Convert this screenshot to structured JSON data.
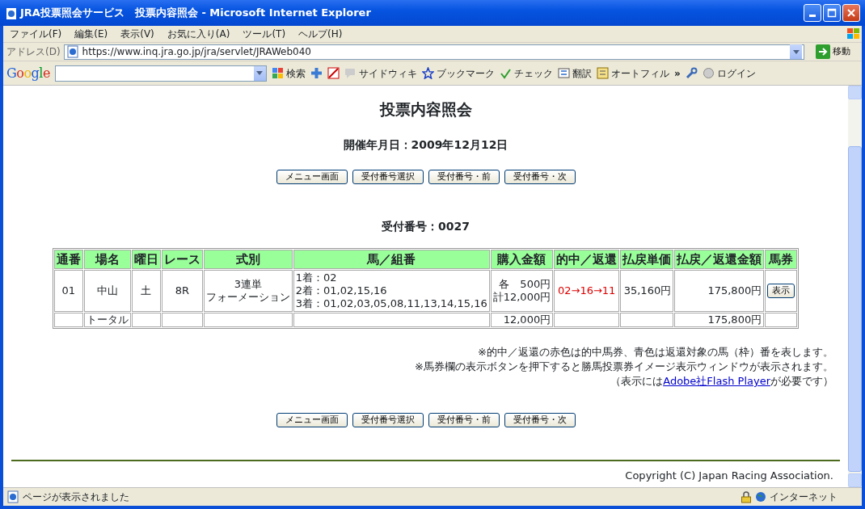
{
  "window": {
    "title": "JRA投票照会サービス　投票内容照会 - Microsoft Internet Explorer"
  },
  "menu": [
    "ファイル(F)",
    "編集(E)",
    "表示(V)",
    "お気に入り(A)",
    "ツール(T)",
    "ヘルプ(H)"
  ],
  "address_bar": {
    "label": "アドレス(D)",
    "url": "https://www.inq.jra.go.jp/jra/servlet/JRAWeb040",
    "go": "移動"
  },
  "google_toolbar": {
    "logo": "Google",
    "items": [
      {
        "label": "検索"
      },
      {
        "label": "サイドウィキ"
      },
      {
        "label": "ブックマーク"
      },
      {
        "label": "チェック"
      },
      {
        "label": "翻訳"
      },
      {
        "label": "オートフィル"
      },
      {
        "label": "»"
      },
      {
        "label": "ログイン"
      }
    ]
  },
  "page": {
    "heading": "投票内容照会",
    "date": "開催年月日：2009年12月12日",
    "nav_buttons_top": [
      "メニュー画面",
      "受付番号選択",
      "受付番号・前",
      "受付番号・次"
    ],
    "receipt": "受付番号：0027",
    "table": {
      "columns": [
        "通番",
        "場名",
        "曜日",
        "レース",
        "式別",
        "馬／組番",
        "購入金額",
        "的中／返還",
        "払戻単価",
        "払戻／返還金額",
        "馬券"
      ],
      "rows": [
        {
          "no": "01",
          "venue": "中山",
          "day": "土",
          "race": "8R",
          "bet_type": [
            "3連単",
            "フォーメーション"
          ],
          "horses": [
            "1着：02",
            "2着：01,02,15,16",
            "3着：01,02,03,05,08,11,13,14,15,16"
          ],
          "amount": [
            "各　500円",
            "計12,000円"
          ],
          "result": {
            "text": "02→16→11",
            "kind": "hit"
          },
          "unit_payout": "35,160円",
          "payout": "175,800円",
          "ticket_button": "表示"
        }
      ],
      "total": {
        "label": "トータル",
        "amount": "12,000円",
        "payout": "175,800円"
      }
    },
    "notes": [
      "※的中／返還の赤色は的中馬券、青色は返還対象の馬（枠）番を表します。",
      "※馬券欄の表示ボタンを押下すると勝馬投票券イメージ表示ウィンドウが表示されます。"
    ],
    "flash_note": {
      "before": "（表示には",
      "link": "Adobe社Flash Player",
      "after": "が必要です）"
    },
    "nav_buttons_bottom": [
      "メニュー画面",
      "受付番号選択",
      "受付番号・前",
      "受付番号・次"
    ],
    "copyright": "Copyright (C) Japan Racing Association."
  },
  "status_bar": {
    "text": "ページが表示されました",
    "zone": "インターネット"
  }
}
